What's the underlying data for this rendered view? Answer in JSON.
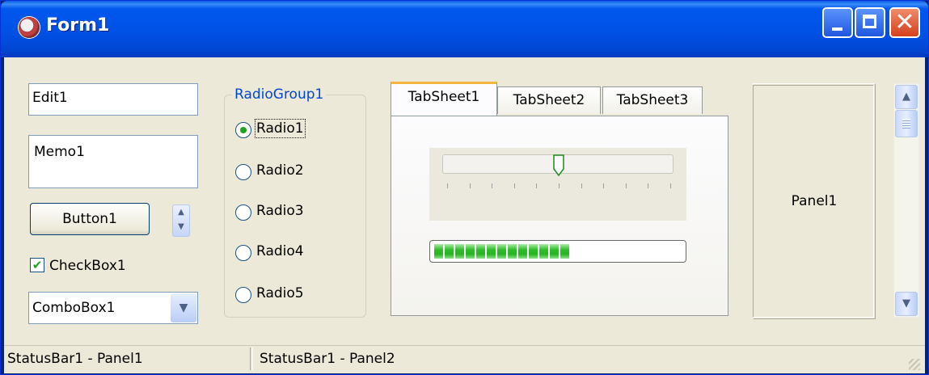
{
  "window": {
    "title": "Form1"
  },
  "edit": {
    "value": "Edit1"
  },
  "memo": {
    "value": "Memo1"
  },
  "button": {
    "label": "Button1"
  },
  "checkbox": {
    "label": "CheckBox1",
    "checked": true
  },
  "combobox": {
    "value": "ComboBox1"
  },
  "radiogroup": {
    "caption": "RadioGroup1",
    "items": [
      "Radio1",
      "Radio2",
      "Radio3",
      "Radio4",
      "Radio5"
    ],
    "selected_index": 0
  },
  "tabs": {
    "items": [
      "TabSheet1",
      "TabSheet2",
      "TabSheet3"
    ],
    "active_index": 0
  },
  "trackbar": {
    "min": 0,
    "max": 10,
    "position": 5
  },
  "progressbar": {
    "percent": 55
  },
  "panel": {
    "caption": "Panel1"
  },
  "statusbar": {
    "panels": [
      "StatusBar1 - Panel1",
      "StatusBar1 - Panel2"
    ]
  },
  "colors": {
    "title_bar": "#0054e3",
    "client_bg": "#ece9d8",
    "tab_highlight": "#f3b53b",
    "progress_fill": "#2fbc2a"
  },
  "icons": {
    "app": "app-icon",
    "minimize": "minimize-icon",
    "maximize": "maximize-icon",
    "close": "close-icon"
  }
}
